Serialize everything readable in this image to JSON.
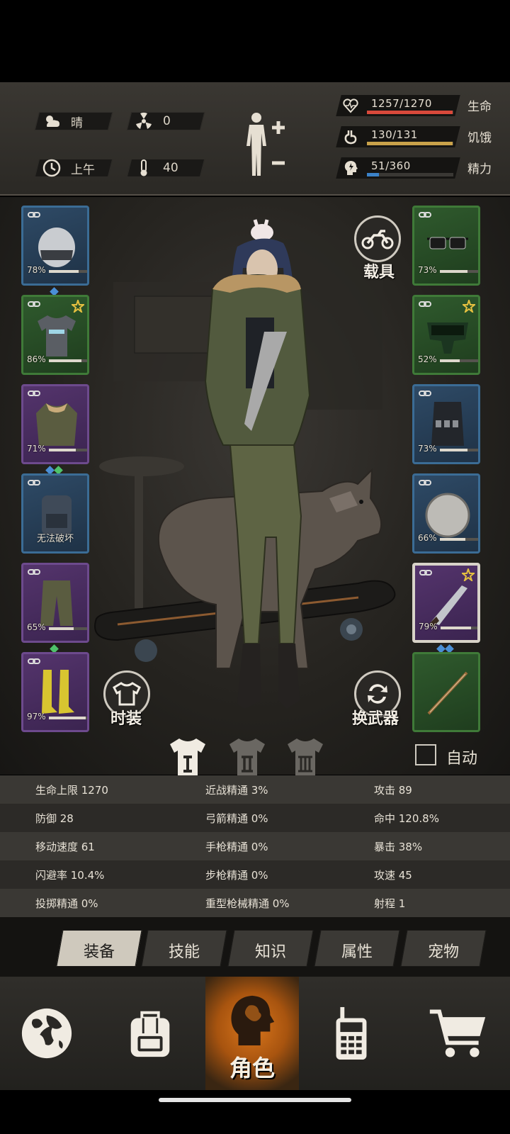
{
  "status": {
    "weather": "晴",
    "radiation": "0",
    "time_of_day": "上午",
    "temperature": "40"
  },
  "vitals": [
    {
      "label": "生命",
      "value": "1257/1270",
      "fraction": 0.99,
      "color": "#d9493b",
      "icon": "heart-icon"
    },
    {
      "label": "饥饿",
      "value": "130/131",
      "fraction": 0.99,
      "color": "#c9a24a",
      "icon": "stomach-icon"
    },
    {
      "label": "精力",
      "value": "51/360",
      "fraction": 0.14,
      "color": "#3b82c8",
      "icon": "head-energy-icon"
    }
  ],
  "left_slots": [
    {
      "name": "helmet",
      "rarity": "blue",
      "durability": "78%",
      "fraction": 0.78,
      "starred": false
    },
    {
      "name": "shirt",
      "rarity": "green",
      "durability": "86%",
      "fraction": 0.86,
      "starred": true
    },
    {
      "name": "jacket",
      "rarity": "purple",
      "durability": "71%",
      "fraction": 0.71,
      "starred": false
    },
    {
      "name": "backpack",
      "rarity": "blue",
      "durability": "无法破坏",
      "fraction": null,
      "starred": false
    },
    {
      "name": "pants",
      "rarity": "purple",
      "durability": "65%",
      "fraction": 0.65,
      "starred": false
    },
    {
      "name": "boots",
      "rarity": "purple",
      "durability": "97%",
      "fraction": 0.97,
      "starred": false
    }
  ],
  "right_slots": [
    {
      "name": "glasses",
      "rarity": "green",
      "durability": "73%",
      "fraction": 0.73,
      "starred": false
    },
    {
      "name": "mask",
      "rarity": "green",
      "durability": "52%",
      "fraction": 0.52,
      "starred": true
    },
    {
      "name": "vest",
      "rarity": "blue",
      "durability": "73%",
      "fraction": 0.73,
      "starred": false
    },
    {
      "name": "shield",
      "rarity": "blue",
      "durability": "66%",
      "fraction": 0.66,
      "starred": false
    },
    {
      "name": "machete",
      "rarity": "purple",
      "durability": "79%",
      "fraction": 0.79,
      "starred": true
    },
    {
      "name": "bow",
      "rarity": "green",
      "durability": "",
      "fraction": null,
      "starred": false
    }
  ],
  "buttons": {
    "vehicle": "载具",
    "fashion": "时装",
    "swap_weapon": "换武器",
    "auto": "自动"
  },
  "stats": [
    [
      "生命上限 1270",
      "近战精通 3%",
      "攻击 89"
    ],
    [
      "防御 28",
      "弓箭精通 0%",
      "命中 120.8%"
    ],
    [
      "移动速度 61",
      "手枪精通 0%",
      "暴击 38%"
    ],
    [
      "闪避率 10.4%",
      "步枪精通 0%",
      "攻速 45"
    ],
    [
      "投掷精通 0%",
      "重型枪械精通 0%",
      "射程 1"
    ]
  ],
  "tabs": [
    "装备",
    "技能",
    "知识",
    "属性",
    "宠物"
  ],
  "active_tab": 0,
  "nav": {
    "items": [
      "globe-icon",
      "backpack-icon",
      "character-icon",
      "walkie-talkie-icon",
      "cart-icon"
    ],
    "active_label": "角色"
  }
}
